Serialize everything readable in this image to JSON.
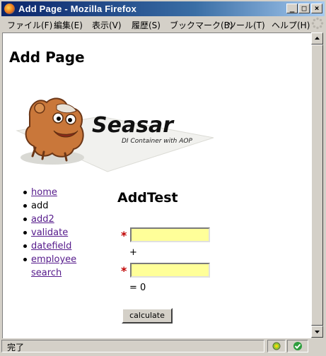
{
  "window": {
    "title": "Add Page - Mozilla Firefox"
  },
  "menu": {
    "items": [
      "ファイル(F)",
      "編集(E)",
      "表示(V)",
      "履歴(S)",
      "ブックマーク(B)",
      "ツール(T)",
      "ヘルプ(H)"
    ]
  },
  "page": {
    "title": "Add Page",
    "logo": {
      "brand": "Seasar",
      "tagline": "DI Container with AOP"
    },
    "nav": [
      "home",
      "add",
      "add2",
      "validate",
      "datefield",
      "employee",
      "search"
    ],
    "form": {
      "heading": "AddTest",
      "required_mark": "*",
      "arg1_value": "",
      "plus": "+",
      "arg2_value": "",
      "result": "= 0",
      "calculate_label": "calculate"
    }
  },
  "status": {
    "text": "完了"
  },
  "colors": {
    "title_bar": "#0a246a",
    "input_bg": "#ffff99",
    "link": "#551a8b",
    "required": "#c00000"
  }
}
